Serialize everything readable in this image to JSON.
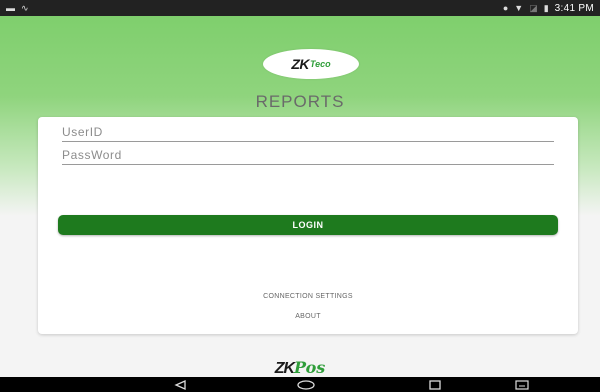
{
  "status_bar": {
    "time": "3:41 PM",
    "left_icons": [
      "image-icon",
      "signal-wave-icon"
    ],
    "right_icons": [
      "circle-icon",
      "wifi-icon",
      "sim-icon",
      "battery-icon"
    ]
  },
  "header": {
    "logo_zk": "ZK",
    "logo_teco": "Teco",
    "title": "REPORTS"
  },
  "form": {
    "user_placeholder": "UserID",
    "user_value": "",
    "pass_placeholder": "PassWord",
    "pass_value": "",
    "login_label": "LOGIN",
    "connection_settings_label": "CONNECTION SETTINGS",
    "about_label": "ABOUT"
  },
  "footer": {
    "logo_zk": "ZK",
    "logo_pos": "Pos"
  },
  "colors": {
    "header_green": "#7fcf6d",
    "login_button": "#1e7a1e",
    "brand_green": "#2f9e3a"
  },
  "nav_bar": {
    "icons": [
      "back-icon",
      "home-icon",
      "recent-apps-icon",
      "keyboard-icon"
    ]
  }
}
